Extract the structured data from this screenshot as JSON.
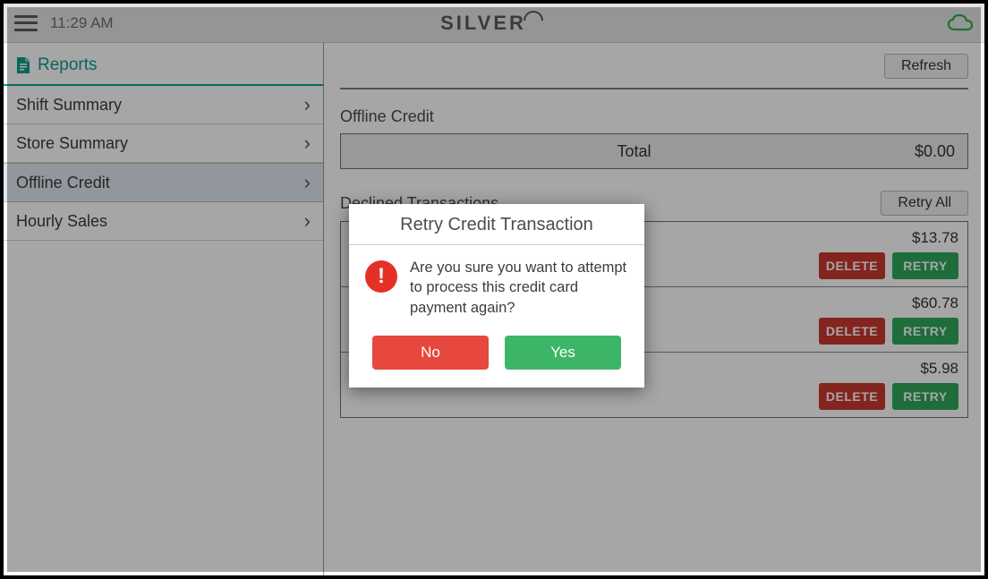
{
  "topbar": {
    "time": "11:29 AM",
    "brand": "SILVER"
  },
  "sidebar": {
    "title": "Reports",
    "items": [
      {
        "label": "Shift Summary",
        "active": false
      },
      {
        "label": "Store Summary",
        "active": false
      },
      {
        "label": "Offline Credit",
        "active": true
      },
      {
        "label": "Hourly Sales",
        "active": false
      }
    ]
  },
  "main": {
    "refresh_label": "Refresh",
    "offline_credit_label": "Offline Credit",
    "total_label": "Total",
    "total_value": "$0.00",
    "declined_label": "Declined Transactions",
    "retry_all_label": "Retry All",
    "delete_label": "DELETE",
    "retry_label": "RETRY",
    "transactions": [
      {
        "amount": "$13.78"
      },
      {
        "amount": "$60.78"
      },
      {
        "amount": "$5.98"
      }
    ]
  },
  "modal": {
    "title": "Retry Credit Transaction",
    "message": "Are you sure you want to attempt to process this credit card payment again?",
    "no_label": "No",
    "yes_label": "Yes"
  }
}
